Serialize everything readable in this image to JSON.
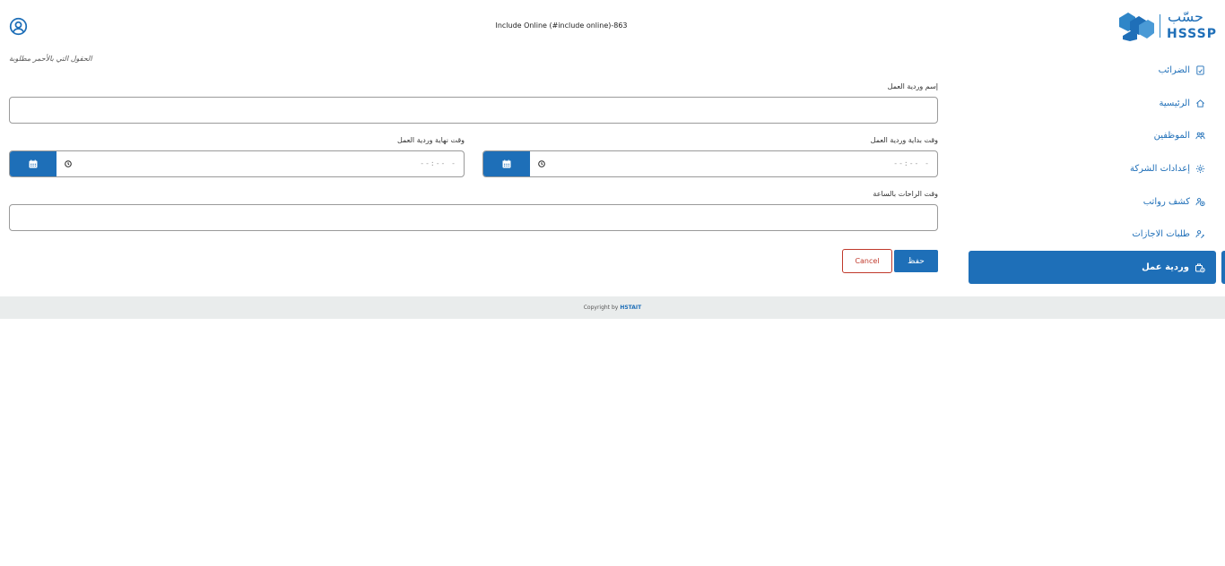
{
  "header": {
    "title": "Include Online (#include online)-863"
  },
  "logo": {
    "arabic": "حسّب",
    "english": "HSSSP"
  },
  "form": {
    "required_note": "الحقول التي بالأحمر مطلوبة",
    "shift_name_label": "إسم وردية العمل",
    "start_time_label": "وقت بداية وردية العمل",
    "end_time_label": "وقت نهاية وردية العمل",
    "break_hours_label": "وقت الراحات بالساعة",
    "time_placeholder": "--:-- -",
    "save_label": "حفظ",
    "cancel_label": "Cancel"
  },
  "sidebar": {
    "items": [
      {
        "label": "الضرائب",
        "icon": "tax-document-icon"
      },
      {
        "label": "الرئيسية",
        "icon": "home-icon"
      },
      {
        "label": "الموظفين",
        "icon": "users-icon"
      },
      {
        "label": "إعدادات الشركة",
        "icon": "settings-icon"
      },
      {
        "label": "كشف رواتب",
        "icon": "payroll-icon"
      },
      {
        "label": "طلبات الاجازات",
        "icon": "leave-request-icon"
      }
    ],
    "active": {
      "label": "وردية عمل",
      "icon": "shift-icon"
    }
  },
  "footer": {
    "copyright_prefix": "Copyright by",
    "brand": "HSTAIT"
  },
  "colors": {
    "primary": "#1e6fb8",
    "danger": "#c0392b",
    "footer_bg": "#e9ecec"
  }
}
